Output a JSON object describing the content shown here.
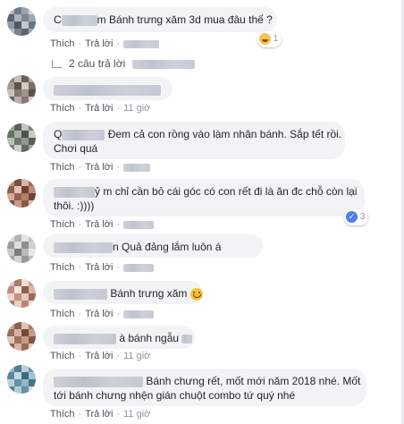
{
  "actions": {
    "like": "Thích",
    "reply": "Trả lời",
    "separator": "·"
  },
  "comments": [
    {
      "name_visible": "C",
      "name_tail": "m",
      "text": "Bánh trưng xăm 3d mua đâu thế ?",
      "time": "",
      "reaction": {
        "icon": "haha-icon",
        "count": "1"
      }
    },
    {
      "name_visible": "",
      "name_tail": "",
      "text": "",
      "time": "11 giờ"
    },
    {
      "name_visible": "Q",
      "name_tail": "",
      "text": "Đem cả con rồng vào làm nhân bánh. Sắp tết rồi.",
      "text2": "Chơi quá",
      "time": ""
    },
    {
      "name_visible": "",
      "name_tail": "ỷ m",
      "text": "chỉ cần bỏ cái góc có con rết đi là ăn đc chỗ còn lại",
      "text2": "thôi. :))))",
      "time": "",
      "reaction": {
        "icon": "like-icon",
        "count": "3"
      }
    },
    {
      "name_visible": "",
      "name_tail": "n",
      "text": "Quả đảng lắm luôn á",
      "time": ""
    },
    {
      "name_visible": "",
      "name_tail": "",
      "text": "Bánh trưng xăm",
      "time": ""
    },
    {
      "name_visible": "",
      "name_tail": "",
      "text": "à bánh ngẫu",
      "time": "11 giờ"
    },
    {
      "name_visible": "",
      "name_tail": "",
      "text": "Bánh chưng rết, mốt mới năm 2018 nhé. Mốt",
      "text2": "tới bánh chưng nhện gián chuột combo tứ quý nhé",
      "time": "11 giờ"
    }
  ],
  "replies_link": "2 câu trả lời",
  "colors": {
    "bubble": "#f2f3f5",
    "meta": "#90949c",
    "text": "#1d2129",
    "link": "#4b4f56"
  }
}
